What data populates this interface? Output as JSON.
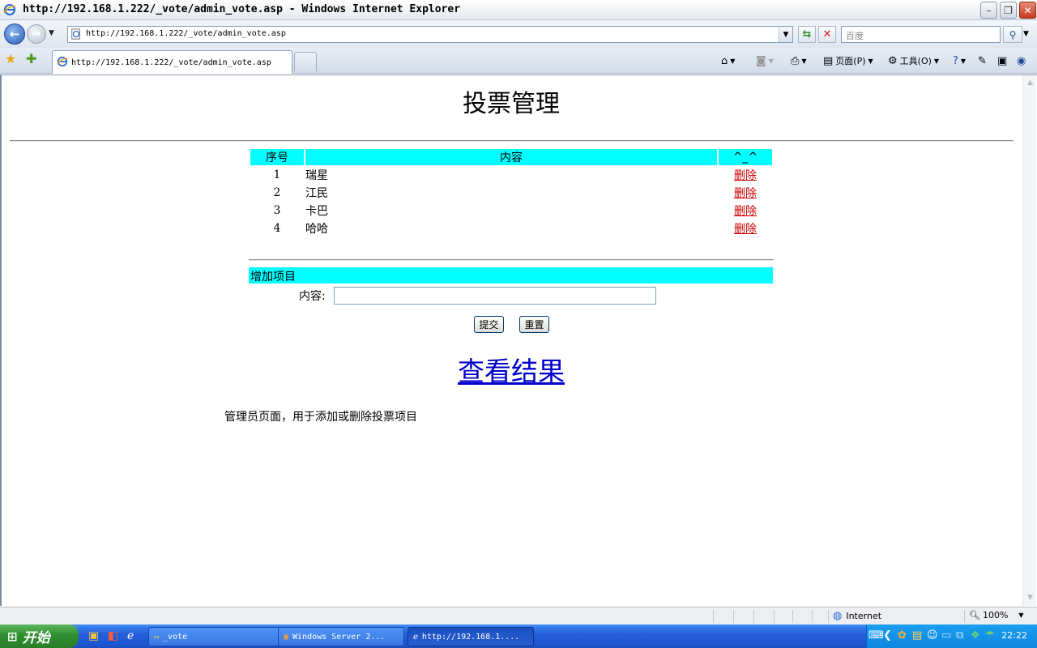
{
  "window": {
    "title": "http://192.168.1.222/_vote/admin_vote.asp - Windows Internet Explorer",
    "minimize": "–",
    "maximize": "❐",
    "close": "✕"
  },
  "addressbar": {
    "url": "http://192.168.1.222/_vote/admin_vote.asp",
    "search_placeholder": "百度"
  },
  "tab": {
    "label": "http://192.168.1.222/_vote/admin_vote.asp"
  },
  "commandbar": {
    "page_label": "页面(P)",
    "tools_label": "工具(O)"
  },
  "page": {
    "title": "投票管理",
    "table": {
      "headers": [
        "序号",
        "内容",
        "^_^"
      ],
      "rows": [
        {
          "index": "1",
          "content": "瑞星",
          "action": "删除"
        },
        {
          "index": "2",
          "content": "江民",
          "action": "删除"
        },
        {
          "index": "3",
          "content": "卡巴",
          "action": "删除"
        },
        {
          "index": "4",
          "content": "哈哈",
          "action": "删除"
        }
      ]
    },
    "add_section": {
      "heading": "增加项目",
      "field_label": "内容:",
      "field_value": "",
      "submit_label": "提交",
      "reset_label": "重置"
    },
    "results_link": "查看结果",
    "note": "管理员页面，用于添加或删除投票项目"
  },
  "statusbar": {
    "zone": "Internet",
    "zoom": "100%"
  },
  "taskbar": {
    "start_label": "开始",
    "tasks": [
      {
        "label": "_vote",
        "active": false
      },
      {
        "label": "Windows Server 2...",
        "active": false
      },
      {
        "label": "http://192.168.1....",
        "active": true
      }
    ],
    "clock": "22:22"
  },
  "colors": {
    "table_header_bg": "#00ffff",
    "delete_link": "#cc0000",
    "results_link": "#0000cc"
  }
}
